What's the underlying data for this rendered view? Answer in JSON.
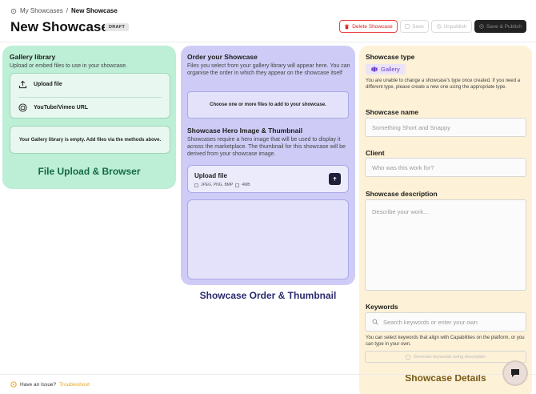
{
  "breadcrumb": {
    "parent": "My Showcases",
    "separator": "/",
    "current": "New Showcase"
  },
  "header": {
    "title": "New Showcase",
    "badge": "DRAFT"
  },
  "actions": {
    "delete_label": "Delete Showcase",
    "save_label": "Save",
    "unpublish_label": "Unpublish",
    "publish_label": "Save & Publish"
  },
  "gallery": {
    "title": "Gallery library",
    "subtitle": "Upload or embed files to use in your showcase.",
    "upload_file": "Upload file",
    "video_url": "YouTube/Vimeo URL",
    "empty_message": "Your Gallery library is empty. Add files via the methods above.",
    "caption": "File Upload & Browser"
  },
  "order": {
    "title": "Order your Showcase",
    "subtitle": "Files you select from your gallery library will appear here. You can organise the order in which they appear on the showcase itself",
    "choose_message": "Choose one or more files to add to your showcase.",
    "hero_title": "Showcase Hero Image & Thumbnail",
    "hero_subtitle": "Showcases require a hero image that will be used to display it across the marketplace. The thumbnail for this showcase will be derived from your showcase image.",
    "hero_upload_label": "Upload file",
    "hero_formats": "JPEG, PNG, BMP",
    "hero_size": "4MB",
    "caption": "Showcase Order & Thumbnail"
  },
  "details": {
    "type_label": "Showcase type",
    "type_value": "Gallery",
    "type_note": "You are unable to change a showcase's type once created. If you need a different type, please create a new one using the appropriate type.",
    "name_label": "Showcase name",
    "name_placeholder": "Something Short and Snappy",
    "client_label": "Client",
    "client_placeholder": "Who was this work for?",
    "description_label": "Showcase description",
    "description_placeholder": "Describe your work...",
    "keywords_label": "Keywords",
    "keywords_placeholder": "Search keywords or enter your own",
    "keywords_note": "You can select keywords that align with Capabilities on the platform, or you can type in your own.",
    "generate_label": "Generate keywords using description",
    "caption": "Showcase Details"
  },
  "footer": {
    "text": "Have an Issue?",
    "link": "Troubleshoot"
  },
  "colors": {
    "gallery_panel": "#bdeed6",
    "order_panel": "#ceccf6",
    "details_panel": "#fdf1d7",
    "gallery_caption": "#136b46",
    "order_caption": "#2a2a6e",
    "details_caption": "#7a5a18",
    "danger": "#e44444"
  }
}
